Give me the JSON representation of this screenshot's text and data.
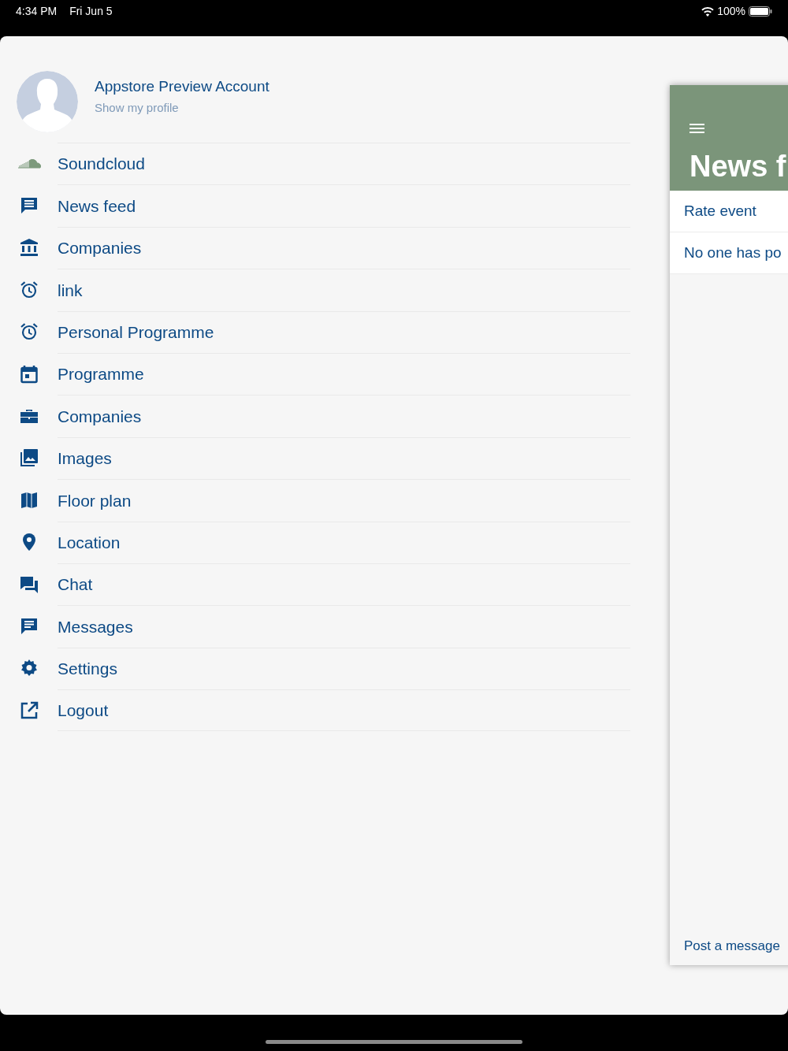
{
  "status_bar": {
    "time": "4:34 PM",
    "date": "Fri Jun 5",
    "battery": "100%"
  },
  "profile": {
    "name": "Appstore Preview Account",
    "link": "Show my profile"
  },
  "menu": [
    {
      "label": "Soundcloud"
    },
    {
      "label": "News feed"
    },
    {
      "label": "Companies"
    },
    {
      "label": "link"
    },
    {
      "label": "Personal Programme"
    },
    {
      "label": "Programme"
    },
    {
      "label": "Companies"
    },
    {
      "label": "Images"
    },
    {
      "label": "Floor plan"
    },
    {
      "label": "Location"
    },
    {
      "label": "Chat"
    },
    {
      "label": "Messages"
    },
    {
      "label": "Settings"
    },
    {
      "label": "Logout"
    }
  ],
  "page": {
    "title": "News f",
    "rows": [
      "Rate event",
      "No one has po"
    ],
    "footer_link": "Post a message"
  }
}
